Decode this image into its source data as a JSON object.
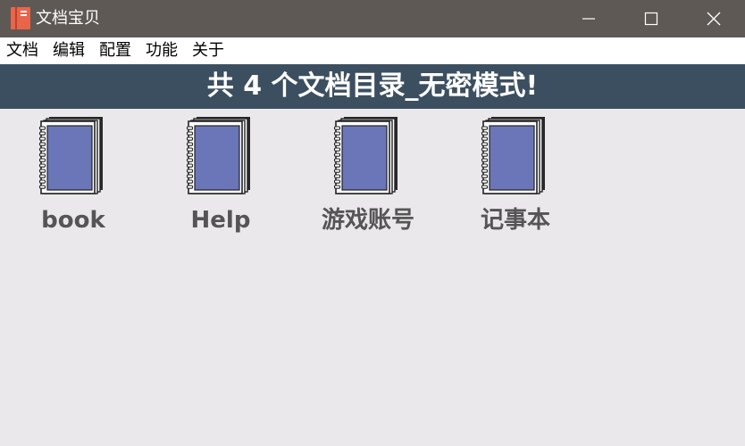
{
  "window": {
    "title": "文档宝贝",
    "icon": "notebook-icon",
    "controls": [
      "minimize-icon",
      "maximize-icon",
      "close-icon"
    ]
  },
  "menu": {
    "items": [
      "文档",
      "编辑",
      "配置",
      "功能",
      "关于"
    ]
  },
  "banner": {
    "text": "共 4 个文档目录_无密模式!"
  },
  "directories": [
    {
      "label": "book",
      "icon": "notebook-icon"
    },
    {
      "label": "Help",
      "icon": "notebook-icon"
    },
    {
      "label": "游戏账号",
      "icon": "notebook-icon"
    },
    {
      "label": "记事本",
      "icon": "notebook-icon"
    }
  ],
  "colors": {
    "titlebar": "#5e5955",
    "banner": "#3c4f60",
    "background": "#ebe8eb",
    "book_cover": "#6b76b8",
    "app_icon": "#e8654a",
    "label_text": "#555555"
  }
}
